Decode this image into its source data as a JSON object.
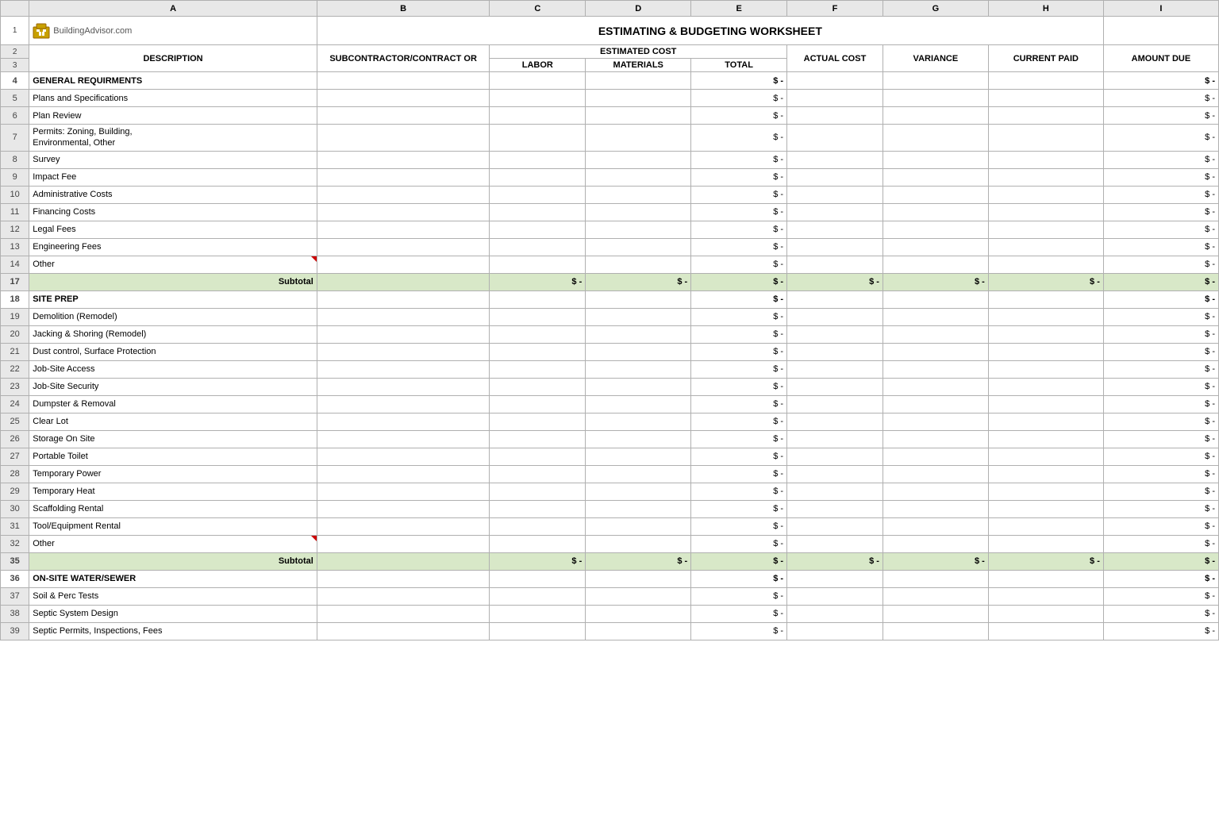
{
  "app": {
    "title": "ESTIMATING & BUDGETING WORKSHEET",
    "logo_text": "BuildingAdvisor.com"
  },
  "columns": {
    "row_num": "#",
    "a": "A",
    "b": "B",
    "c": "C",
    "d": "D",
    "e": "E",
    "f": "F",
    "g": "G",
    "h": "H",
    "i": "I"
  },
  "headers": {
    "description": "DESCRIPTION",
    "subcontractor": "SUBCONTRACTOR/CONTRACT OR",
    "estimated_cost": "ESTIMATED COST",
    "labor": "LABOR",
    "materials": "MATERIALS",
    "total": "TOTAL",
    "actual_cost": "ACTUAL COST",
    "variance": "VARIANCE",
    "current_paid": "CURRENT PAID",
    "amount_due": "AMOUNT DUE"
  },
  "rows": [
    {
      "num": "4",
      "type": "section",
      "desc": "GENERAL REQUIRMENTS",
      "subcontract": "",
      "labor": "",
      "materials": "",
      "total": "$ -",
      "actual": "",
      "variance": "",
      "current_paid": "",
      "amount_due": "$ -"
    },
    {
      "num": "5",
      "type": "data",
      "desc": "Plans and Specifications",
      "subcontract": "",
      "labor": "",
      "materials": "",
      "total": "$ -",
      "actual": "",
      "variance": "",
      "current_paid": "",
      "amount_due": "$ -"
    },
    {
      "num": "6",
      "type": "data",
      "desc": "Plan Review",
      "subcontract": "",
      "labor": "",
      "materials": "",
      "total": "$ -",
      "actual": "",
      "variance": "",
      "current_paid": "",
      "amount_due": "$ -"
    },
    {
      "num": "7",
      "type": "data",
      "desc": "Permits: Zoning, Building,\nEnvironmental, Other",
      "subcontract": "",
      "labor": "",
      "materials": "",
      "total": "$ -",
      "actual": "",
      "variance": "",
      "current_paid": "",
      "amount_due": "$ -",
      "twoLine": true
    },
    {
      "num": "8",
      "type": "data",
      "desc": "Survey",
      "subcontract": "",
      "labor": "",
      "materials": "",
      "total": "$ -",
      "actual": "",
      "variance": "",
      "current_paid": "",
      "amount_due": "$ -"
    },
    {
      "num": "9",
      "type": "data",
      "desc": "Impact Fee",
      "subcontract": "",
      "labor": "",
      "materials": "",
      "total": "$ -",
      "actual": "",
      "variance": "",
      "current_paid": "",
      "amount_due": "$ -"
    },
    {
      "num": "10",
      "type": "data",
      "desc": "Administrative Costs",
      "subcontract": "",
      "labor": "",
      "materials": "",
      "total": "$ -",
      "actual": "",
      "variance": "",
      "current_paid": "",
      "amount_due": "$ -"
    },
    {
      "num": "11",
      "type": "data",
      "desc": "Financing Costs",
      "subcontract": "",
      "labor": "",
      "materials": "",
      "total": "$ -",
      "actual": "",
      "variance": "",
      "current_paid": "",
      "amount_due": "$ -"
    },
    {
      "num": "12",
      "type": "data",
      "desc": "Legal Fees",
      "subcontract": "",
      "labor": "",
      "materials": "",
      "total": "$ -",
      "actual": "",
      "variance": "",
      "current_paid": "",
      "amount_due": "$ -"
    },
    {
      "num": "13",
      "type": "data",
      "desc": "Engineering Fees",
      "subcontract": "",
      "labor": "",
      "materials": "",
      "total": "$ -",
      "actual": "",
      "variance": "",
      "current_paid": "",
      "amount_due": "$ -"
    },
    {
      "num": "14",
      "type": "data",
      "desc": "Other",
      "subcontract": "",
      "labor": "",
      "materials": "",
      "total": "$ -",
      "actual": "",
      "variance": "",
      "current_paid": "",
      "amount_due": "$ -",
      "redTriangle": true
    },
    {
      "num": "17",
      "type": "subtotal",
      "desc": "Subtotal",
      "subcontract": "",
      "labor": "$ -",
      "materials": "$ -",
      "total": "$ -",
      "actual": "$ -",
      "variance": "$ -",
      "current_paid": "$ -",
      "amount_due": "$ -"
    },
    {
      "num": "18",
      "type": "section",
      "desc": "SITE PREP",
      "subcontract": "",
      "labor": "",
      "materials": "",
      "total": "$ -",
      "actual": "",
      "variance": "",
      "current_paid": "",
      "amount_due": "$ -"
    },
    {
      "num": "19",
      "type": "data",
      "desc": "Demolition (Remodel)",
      "subcontract": "",
      "labor": "",
      "materials": "",
      "total": "$ -",
      "actual": "",
      "variance": "",
      "current_paid": "",
      "amount_due": "$ -"
    },
    {
      "num": "20",
      "type": "data",
      "desc": "Jacking & Shoring (Remodel)",
      "subcontract": "",
      "labor": "",
      "materials": "",
      "total": "$ -",
      "actual": "",
      "variance": "",
      "current_paid": "",
      "amount_due": "$ -"
    },
    {
      "num": "21",
      "type": "data",
      "desc": "Dust control, Surface Protection",
      "subcontract": "",
      "labor": "",
      "materials": "",
      "total": "$ -",
      "actual": "",
      "variance": "",
      "current_paid": "",
      "amount_due": "$ -"
    },
    {
      "num": "22",
      "type": "data",
      "desc": "Job-Site Access",
      "subcontract": "",
      "labor": "",
      "materials": "",
      "total": "$ -",
      "actual": "",
      "variance": "",
      "current_paid": "",
      "amount_due": "$ -"
    },
    {
      "num": "23",
      "type": "data",
      "desc": "Job-Site Security",
      "subcontract": "",
      "labor": "",
      "materials": "",
      "total": "$ -",
      "actual": "",
      "variance": "",
      "current_paid": "",
      "amount_due": "$ -"
    },
    {
      "num": "24",
      "type": "data",
      "desc": "Dumpster & Removal",
      "subcontract": "",
      "labor": "",
      "materials": "",
      "total": "$ -",
      "actual": "",
      "variance": "",
      "current_paid": "",
      "amount_due": "$ -"
    },
    {
      "num": "25",
      "type": "data",
      "desc": "Clear Lot",
      "subcontract": "",
      "labor": "",
      "materials": "",
      "total": "$ -",
      "actual": "",
      "variance": "",
      "current_paid": "",
      "amount_due": "$ -"
    },
    {
      "num": "26",
      "type": "data",
      "desc": "Storage On Site",
      "subcontract": "",
      "labor": "",
      "materials": "",
      "total": "$ -",
      "actual": "",
      "variance": "",
      "current_paid": "",
      "amount_due": "$ -"
    },
    {
      "num": "27",
      "type": "data",
      "desc": "Portable Toilet",
      "subcontract": "",
      "labor": "",
      "materials": "",
      "total": "$ -",
      "actual": "",
      "variance": "",
      "current_paid": "",
      "amount_due": "$ -"
    },
    {
      "num": "28",
      "type": "data",
      "desc": "Temporary Power",
      "subcontract": "",
      "labor": "",
      "materials": "",
      "total": "$ -",
      "actual": "",
      "variance": "",
      "current_paid": "",
      "amount_due": "$ -"
    },
    {
      "num": "29",
      "type": "data",
      "desc": "Temporary Heat",
      "subcontract": "",
      "labor": "",
      "materials": "",
      "total": "$ -",
      "actual": "",
      "variance": "",
      "current_paid": "",
      "amount_due": "$ -"
    },
    {
      "num": "30",
      "type": "data",
      "desc": "Scaffolding Rental",
      "subcontract": "",
      "labor": "",
      "materials": "",
      "total": "$ -",
      "actual": "",
      "variance": "",
      "current_paid": "",
      "amount_due": "$ -"
    },
    {
      "num": "31",
      "type": "data",
      "desc": "Tool/Equipment Rental",
      "subcontract": "",
      "labor": "",
      "materials": "",
      "total": "$ -",
      "actual": "",
      "variance": "",
      "current_paid": "",
      "amount_due": "$ -"
    },
    {
      "num": "32",
      "type": "data",
      "desc": "Other",
      "subcontract": "",
      "labor": "",
      "materials": "",
      "total": "$ -",
      "actual": "",
      "variance": "",
      "current_paid": "",
      "amount_due": "$ -",
      "redTriangle": true
    },
    {
      "num": "35",
      "type": "subtotal",
      "desc": "Subtotal",
      "subcontract": "",
      "labor": "$ -",
      "materials": "$ -",
      "total": "$ -",
      "actual": "$ -",
      "variance": "$ -",
      "current_paid": "$ -",
      "amount_due": "$ -"
    },
    {
      "num": "36",
      "type": "section",
      "desc": "ON-SITE WATER/SEWER",
      "subcontract": "",
      "labor": "",
      "materials": "",
      "total": "$ -",
      "actual": "",
      "variance": "",
      "current_paid": "",
      "amount_due": "$ -"
    },
    {
      "num": "37",
      "type": "data",
      "desc": "Soil & Perc Tests",
      "subcontract": "",
      "labor": "",
      "materials": "",
      "total": "$ -",
      "actual": "",
      "variance": "",
      "current_paid": "",
      "amount_due": "$ -"
    },
    {
      "num": "38",
      "type": "data",
      "desc": "Septic System Design",
      "subcontract": "",
      "labor": "",
      "materials": "",
      "total": "$ -",
      "actual": "",
      "variance": "",
      "current_paid": "",
      "amount_due": "$ -"
    },
    {
      "num": "39",
      "type": "data",
      "desc": "Septic Permits, Inspections, Fees",
      "subcontract": "",
      "labor": "",
      "materials": "",
      "total": "$ -",
      "actual": "",
      "variance": "",
      "current_paid": "",
      "amount_due": "$ -"
    }
  ]
}
